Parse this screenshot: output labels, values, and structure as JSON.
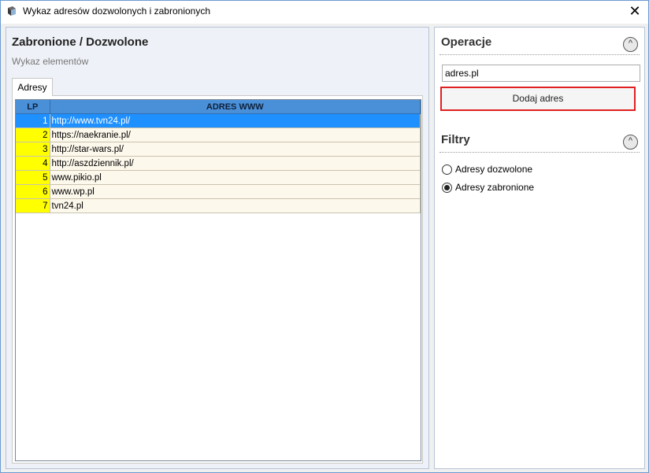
{
  "window": {
    "title": "Wykaz adresów dozwolonych i zabronionych"
  },
  "left_panel": {
    "title": "Zabronione / Dozwolone",
    "subtitle": "Wykaz elementów",
    "tab": "Adresy",
    "columns": [
      "LP",
      "ADRES WWW"
    ],
    "rows": [
      {
        "lp": "1",
        "url": "http://www.tvn24.pl/",
        "selected": true
      },
      {
        "lp": "2",
        "url": "https://naekranie.pl/",
        "selected": false
      },
      {
        "lp": "3",
        "url": "http://star-wars.pl/",
        "selected": false
      },
      {
        "lp": "4",
        "url": "http://aszdziennik.pl/",
        "selected": false
      },
      {
        "lp": "5",
        "url": "www.pikio.pl",
        "selected": false
      },
      {
        "lp": "6",
        "url": "www.wp.pl",
        "selected": false
      },
      {
        "lp": "7",
        "url": "tvn24.pl",
        "selected": false
      }
    ]
  },
  "operations": {
    "title": "Operacje",
    "input_value": "adres.pl",
    "add_button": "Dodaj adres"
  },
  "filters": {
    "title": "Filtry",
    "options": [
      {
        "label": "Adresy dozwolone",
        "checked": false
      },
      {
        "label": "Adresy zabronione",
        "checked": true
      }
    ]
  },
  "colors": {
    "header": "#4a90d9",
    "selected_row": "#1e90ff",
    "lp_cell": "#ffff00",
    "highlight_border": "#e02020"
  }
}
